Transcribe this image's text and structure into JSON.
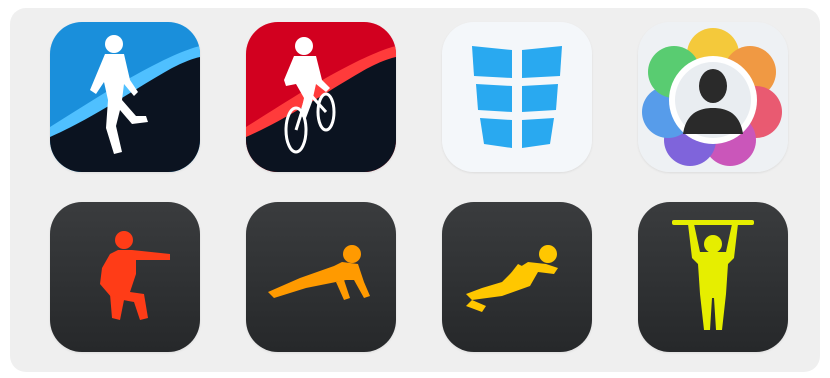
{
  "apps": [
    {
      "id": "running",
      "icon": "runner-icon",
      "colors": {
        "bg": "#1a8fdb",
        "stripe": "#0b1320",
        "accent": "#4fc0ff",
        "figure": "#ffffff"
      }
    },
    {
      "id": "cycling",
      "icon": "cyclist-icon",
      "colors": {
        "bg": "#d2001f",
        "stripe": "#0b1320",
        "accent": "#ff3b3b",
        "figure": "#ffffff"
      }
    },
    {
      "id": "sixpack",
      "icon": "abs-icon",
      "colors": {
        "bg": "#f4f7fa",
        "figure": "#29a9f0"
      }
    },
    {
      "id": "face",
      "icon": "person-silhouette-icon",
      "colors": {
        "bg": "#eef1f4",
        "figure": "#2a2a2a"
      }
    },
    {
      "id": "squats",
      "icon": "squat-icon",
      "colors": {
        "bg": "#2d2f31",
        "figure": "#ff3c17"
      }
    },
    {
      "id": "pushups",
      "icon": "pushup-icon",
      "colors": {
        "bg": "#2d2f31",
        "figure": "#ff9a00"
      }
    },
    {
      "id": "situps",
      "icon": "situp-icon",
      "colors": {
        "bg": "#2d2f31",
        "figure": "#ffc700"
      }
    },
    {
      "id": "pullups",
      "icon": "pullup-icon",
      "colors": {
        "bg": "#2d2f31",
        "figure": "#e6ee00"
      }
    }
  ]
}
